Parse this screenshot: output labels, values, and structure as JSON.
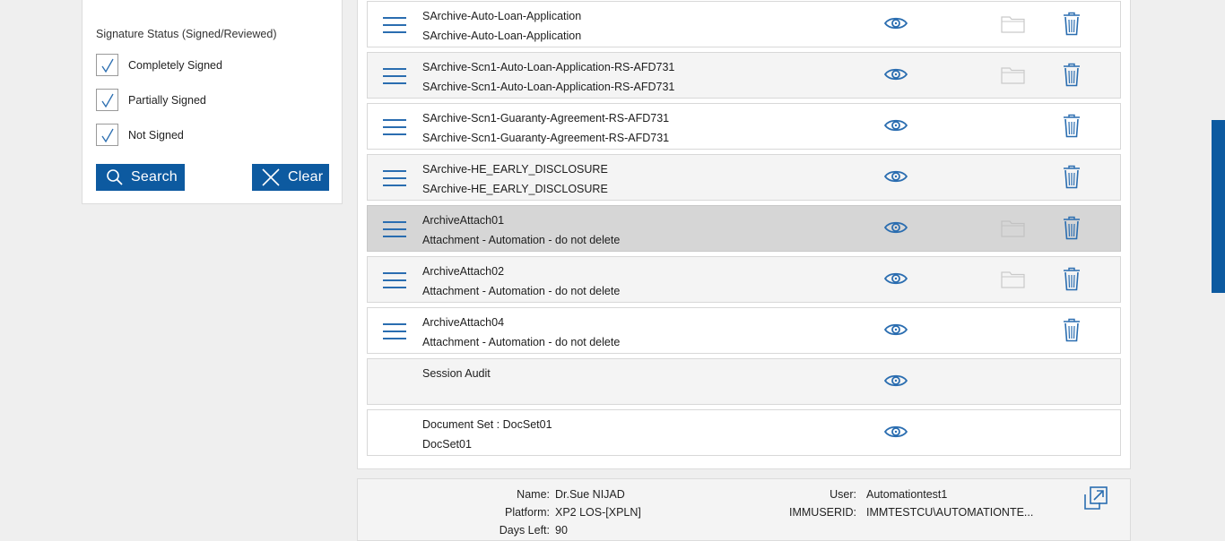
{
  "filter": {
    "title": "Signature Status (Signed/Reviewed)",
    "options": [
      {
        "label": "Completely Signed",
        "checked": true
      },
      {
        "label": "Partially Signed",
        "checked": true
      },
      {
        "label": "Not Signed",
        "checked": true
      }
    ],
    "search_label": "Search",
    "clear_label": "Clear"
  },
  "documents": [
    {
      "line1": "SArchive-Auto-Loan-Application",
      "line2": "SArchive-Auto-Loan-Application",
      "menu": true,
      "folder": true,
      "trash": true
    },
    {
      "line1": "SArchive-Scn1-Auto-Loan-Application-RS-AFD731",
      "line2": "SArchive-Scn1-Auto-Loan-Application-RS-AFD731",
      "menu": true,
      "folder": true,
      "trash": true
    },
    {
      "line1": "SArchive-Scn1-Guaranty-Agreement-RS-AFD731",
      "line2": "SArchive-Scn1-Guaranty-Agreement-RS-AFD731",
      "menu": true,
      "folder": false,
      "trash": true
    },
    {
      "line1": "SArchive-HE_EARLY_DISCLOSURE",
      "line2": "SArchive-HE_EARLY_DISCLOSURE",
      "menu": true,
      "folder": false,
      "trash": true
    },
    {
      "line1": "ArchiveAttach01",
      "line2": "Attachment - Automation - do not delete",
      "menu": true,
      "folder": true,
      "trash": true
    },
    {
      "line1": "ArchiveAttach02",
      "line2": "Attachment - Automation - do not delete",
      "menu": true,
      "folder": true,
      "trash": true
    },
    {
      "line1": "ArchiveAttach04",
      "line2": "Attachment - Automation - do not delete",
      "menu": true,
      "folder": false,
      "trash": true
    },
    {
      "line1": "Session Audit",
      "line2": "",
      "menu": false,
      "folder": false,
      "trash": false
    },
    {
      "line1": "Document Set : DocSet01",
      "line2": "DocSet01",
      "menu": false,
      "folder": false,
      "trash": false
    }
  ],
  "info": {
    "name_label": "Name:",
    "name_value": "Dr.Sue NIJAD",
    "platform_label": "Platform:",
    "platform_value": "XP2 LOS-[XPLN]",
    "days_label": "Days Left:",
    "days_value": "90",
    "user_label": "User:",
    "user_value": "Automationtest1",
    "immuserid_label": "IMMUSERID:",
    "immuserid_value": "IMMTESTCU\\AUTOMATIONTE..."
  },
  "colors": {
    "accent": "#0d5aa0",
    "icon_blue": "#2a6db0",
    "folder_grey": "#c9c9c9",
    "selected_row": "#d6d6d6"
  }
}
